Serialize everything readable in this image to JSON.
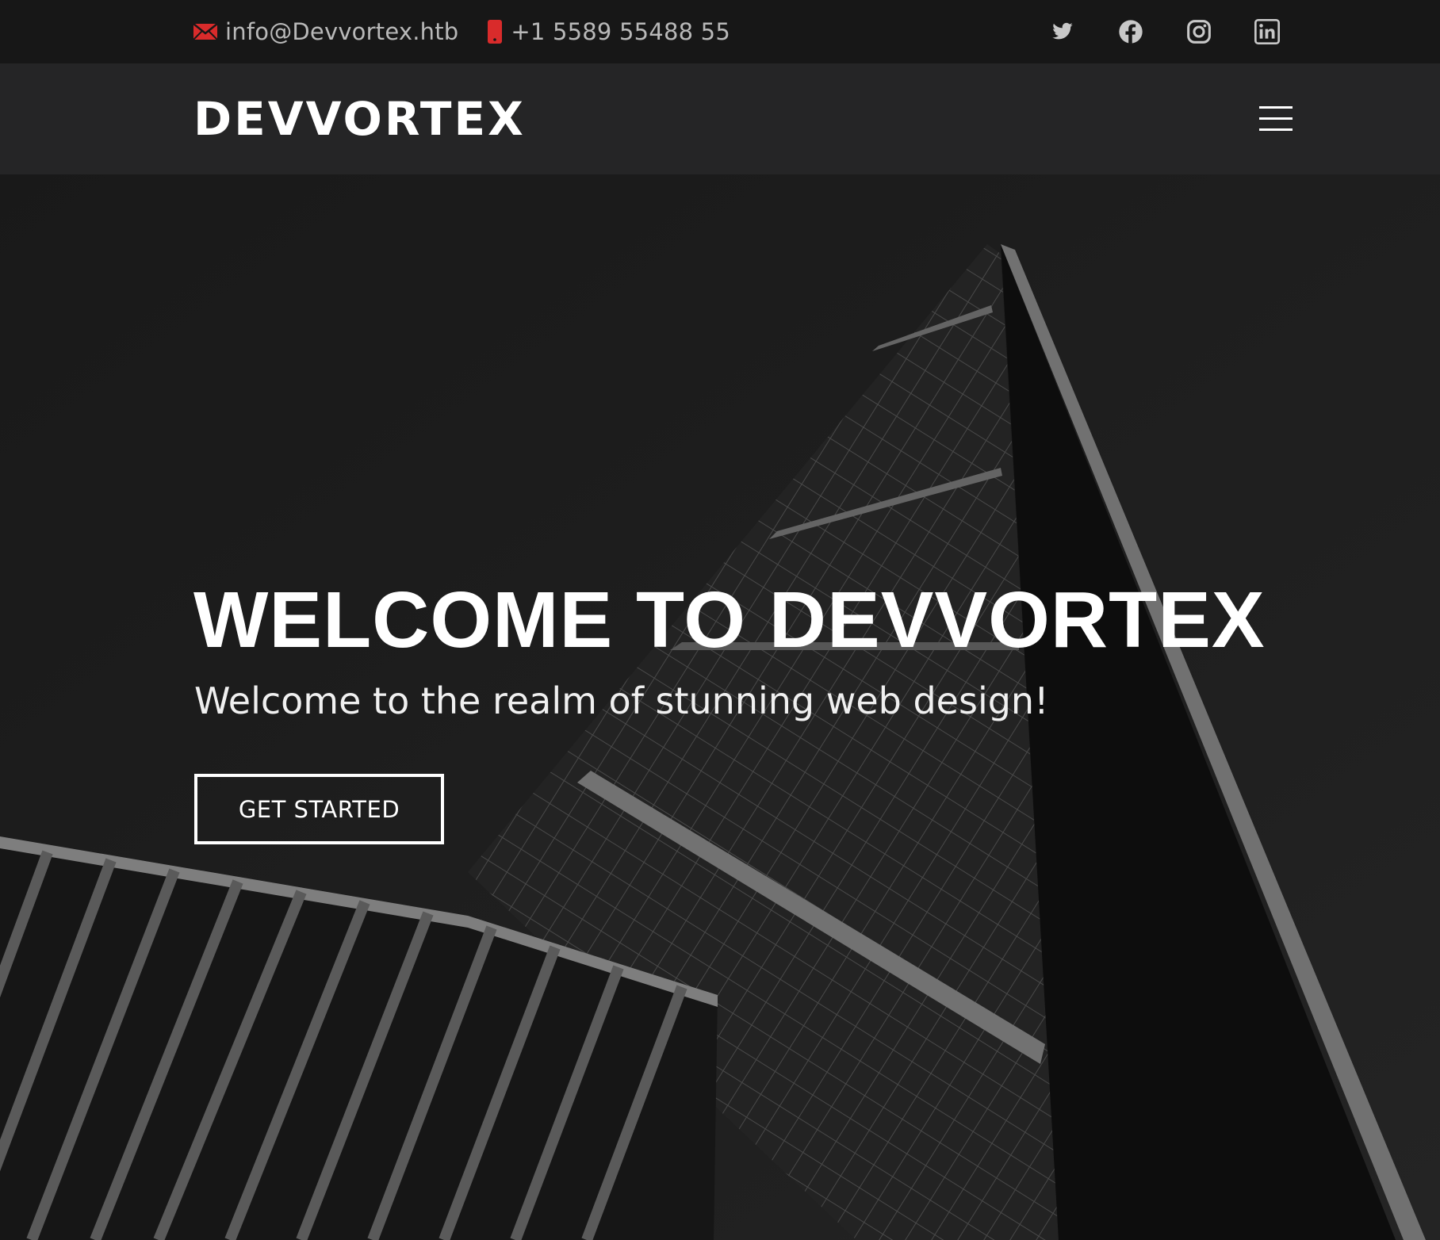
{
  "topbar": {
    "email": "info@Devvortex.htb",
    "phone": "+1 5589 55488 55",
    "email_icon": "envelope-icon",
    "phone_icon": "phone-icon",
    "accent": "#d92b2b",
    "social": [
      "twitter-icon",
      "facebook-icon",
      "instagram-icon",
      "linkedin-icon"
    ]
  },
  "navbar": {
    "logo": "DEVVORTEX",
    "menu_icon": "hamburger-menu-icon"
  },
  "hero": {
    "title": "WELCOME TO DEVVORTEX",
    "subtitle": "Welcome to the realm of stunning web design!",
    "cta_label": "GET STARTED"
  }
}
